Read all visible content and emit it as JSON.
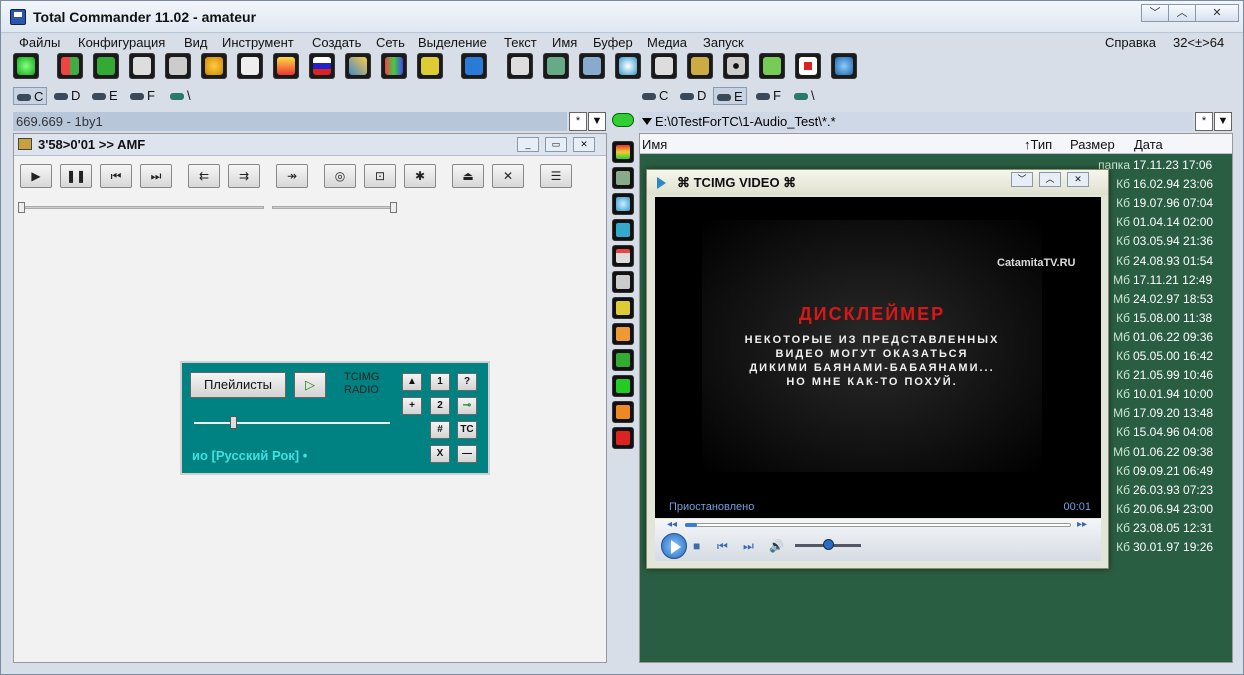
{
  "window": {
    "title": "Total Commander 11.02 - amateur",
    "controls": [
      "﹀",
      "︿",
      "✕"
    ]
  },
  "menu": {
    "items": [
      "Файлы",
      "Конфигурация",
      "Вид",
      "Инструмент",
      "Создать",
      "Сеть",
      "Выделение",
      "Текст",
      "Имя",
      "Буфер",
      "Медиа",
      "Запуск"
    ],
    "help": "Справка",
    "bitness": "32<±>64"
  },
  "toolbar": {
    "icons": [
      "power-icon",
      "windows-icon",
      "shield-icon",
      "clapper-icon",
      "speaker-icon",
      "palette-icon",
      "printer-icon",
      "tools-icon",
      "flag-icon",
      "edit-icon",
      "grid-icon",
      "upload-icon",
      "tc-icon",
      "camera-icon",
      "monitor-icon",
      "hammer-icon",
      "disc-icon",
      "document-icon",
      "plugin-icon",
      "cd-icon",
      "usb-icon",
      "medkit-icon",
      "globe-icon"
    ]
  },
  "left_drives": [
    {
      "label": "C",
      "active": true
    },
    {
      "label": "D",
      "active": false
    },
    {
      "label": "E",
      "active": false
    },
    {
      "label": "F",
      "active": false
    },
    {
      "label": "\\",
      "active": false
    }
  ],
  "right_drives": [
    {
      "label": "C",
      "active": false
    },
    {
      "label": "D",
      "active": false
    },
    {
      "label": "E",
      "active": true
    },
    {
      "label": "F",
      "active": false
    },
    {
      "label": "\\",
      "active": false
    }
  ],
  "left_path": "669.669 - 1by1",
  "right_path": "E:\\0TestForTC\\1-Audio_Test\\*.*",
  "path_button": "*",
  "path_dropdown": "▼",
  "player": {
    "title": "3'58>0'01 >> AMF",
    "buttons": [
      "▶",
      "❚❚",
      "⏮",
      "⏭",
      "⇇",
      "⇉",
      "↠",
      "◎",
      "⊡",
      "✱",
      "⏏",
      "✕",
      "☰"
    ],
    "window_buttons": [
      "_",
      "▭",
      "✕"
    ]
  },
  "radio": {
    "playlists": "Плейлисты",
    "play": "▷",
    "label_line1": "TCIMG",
    "label_line2": "RADIO",
    "station": "ио [Русский Рок] •",
    "keys": [
      "▲",
      "1",
      "?",
      "+",
      "2",
      "⊸",
      "#",
      "TC",
      "X",
      "—"
    ]
  },
  "right_panel": {
    "headers": {
      "name": "Имя",
      "type": "↑Тип",
      "size": "Размер",
      "date": "Дата"
    },
    "rows": [
      {
        "size": "папка",
        "date": "17.11.23 17:06"
      },
      {
        "size": "Кб",
        "date": "16.02.94 23:06"
      },
      {
        "size": "Кб",
        "date": "19.07.96 07:04"
      },
      {
        "size": "Кб",
        "date": "01.04.14 02:00"
      },
      {
        "size": "Кб",
        "date": "03.05.94 21:36"
      },
      {
        "size": "Кб",
        "date": "24.08.93 01:54"
      },
      {
        "size": "Мб",
        "date": "17.11.21 12:49"
      },
      {
        "size": "Мб",
        "date": "24.02.97 18:53"
      },
      {
        "size": "Кб",
        "date": "15.08.00 11:38"
      },
      {
        "size": "Мб",
        "date": "01.06.22 09:36"
      },
      {
        "size": "Кб",
        "date": "05.05.00 16:42"
      },
      {
        "size": "Кб",
        "date": "21.05.99 10:46"
      },
      {
        "size": "Кб",
        "date": "10.01.94 10:00"
      },
      {
        "size": "Мб",
        "date": "17.09.20 13:48"
      },
      {
        "size": "Кб",
        "date": "15.04.96 04:08"
      },
      {
        "size": "Мб",
        "date": "01.06.22 09:38"
      },
      {
        "size": "Кб",
        "date": "09.09.21 06:49"
      },
      {
        "size": "Кб",
        "date": "26.03.93 07:23"
      },
      {
        "size": "Кб",
        "date": "20.06.94 23:00"
      },
      {
        "size": "Кб",
        "date": "23.08.05 12:31"
      },
      {
        "size": "Кб",
        "date": "30.01.97 19:26"
      }
    ]
  },
  "video": {
    "title": "⌘ TCIMG VIDEO ⌘",
    "logo": "CatamitaTV.RU",
    "disclaimer": "ДИСКЛЕЙМЕР",
    "lines": [
      "НЕКОТОРЫЕ ИЗ ПРЕДСТАВЛЕННЫХ",
      "ВИДЕО МОГУТ ОКАЗАТЬСЯ",
      "ДИКИМИ БАЯНАМИ-БАБАЯНАМИ...",
      "НО МНЕ КАК-ТО ПОХУЙ."
    ],
    "status": "Приостановлено",
    "time": "00:01",
    "seek_progress": 0.03,
    "volume_level": 0.5
  }
}
